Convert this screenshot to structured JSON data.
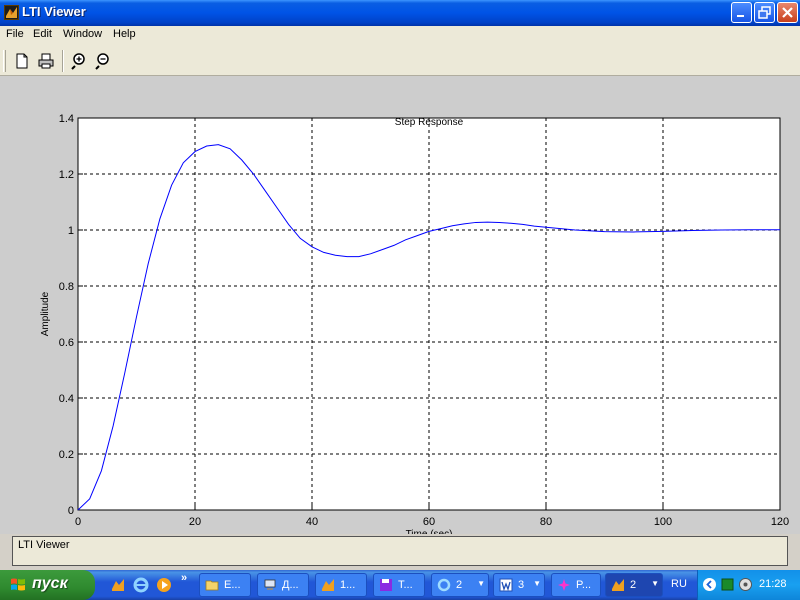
{
  "window": {
    "title": "LTI Viewer"
  },
  "menu": [
    "File",
    "Edit",
    "Window",
    "Help"
  ],
  "toolbar": {
    "icons": [
      "new-document-icon",
      "print-icon",
      "zoom-in-icon",
      "zoom-out-icon"
    ]
  },
  "chart_data": {
    "type": "line",
    "title": "Step Response",
    "xlabel": "Time (sec)",
    "ylabel": "Amplitude",
    "xlim": [
      0,
      120
    ],
    "ylim": [
      0,
      1.4
    ],
    "xticks": [
      0,
      20,
      40,
      60,
      80,
      100,
      120
    ],
    "yticks": [
      0,
      0.2,
      0.4,
      0.6,
      0.8,
      1,
      1.2,
      1.4
    ],
    "grid": true,
    "series": [
      {
        "color": "#0000ff",
        "x": [
          0,
          2,
          4,
          6,
          8,
          10,
          12,
          14,
          16,
          18,
          20,
          22,
          24,
          26,
          28,
          30,
          32,
          34,
          36,
          38,
          40,
          42,
          44,
          46,
          48,
          50,
          52,
          54,
          56,
          58,
          60,
          62,
          64,
          66,
          68,
          70,
          72,
          74,
          76,
          78,
          80,
          85,
          90,
          95,
          100,
          105,
          110,
          115,
          120
        ],
        "y": [
          0,
          0.04,
          0.14,
          0.3,
          0.49,
          0.69,
          0.88,
          1.04,
          1.16,
          1.24,
          1.28,
          1.3,
          1.305,
          1.29,
          1.25,
          1.2,
          1.14,
          1.08,
          1.02,
          0.97,
          0.94,
          0.92,
          0.91,
          0.905,
          0.905,
          0.915,
          0.93,
          0.945,
          0.965,
          0.98,
          0.995,
          1.005,
          1.015,
          1.022,
          1.027,
          1.028,
          1.027,
          1.024,
          1.02,
          1.014,
          1.01,
          1.0,
          0.994,
          0.993,
          0.995,
          0.998,
          1.0,
          1.001,
          1.001
        ]
      }
    ]
  },
  "status": {
    "text": "LTI Viewer"
  },
  "taskbar": {
    "start_label": "пуск",
    "chevron": "»",
    "tasks": [
      {
        "icon": "folder-icon",
        "label": "E..."
      },
      {
        "icon": "computer-icon",
        "label": "Д..."
      },
      {
        "icon": "matlab-icon",
        "label": "1..."
      },
      {
        "icon": "floppy-icon",
        "label": "T..."
      },
      {
        "icon": "ie-icon",
        "label": "2"
      },
      {
        "icon": "word-icon",
        "label": "3"
      },
      {
        "icon": "pink-app-icon",
        "label": "P..."
      },
      {
        "icon": "matlab-icon",
        "label": "2"
      }
    ],
    "language": "RU",
    "clock": "21:28"
  },
  "colors": {
    "titlebar": "#0053e6",
    "plot_background": "#cdcdcd",
    "axes_background": "#ffffff",
    "line": "#0000ff",
    "taskbar": "#2157d7",
    "start_button": "#3c9a3c"
  }
}
